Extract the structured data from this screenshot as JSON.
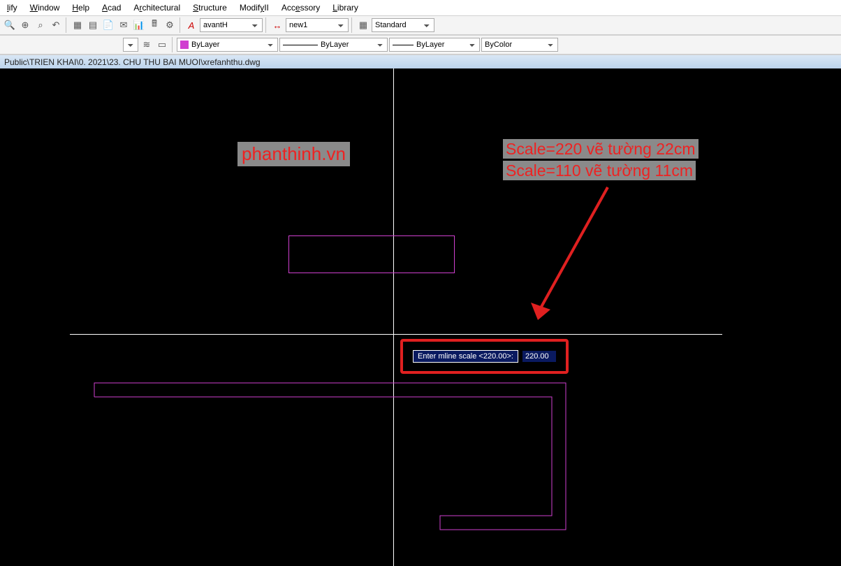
{
  "menu": {
    "items": [
      {
        "pre": "",
        "u": "l",
        "post": "ify"
      },
      {
        "pre": "",
        "u": "W",
        "post": "indow"
      },
      {
        "pre": "",
        "u": "H",
        "post": "elp"
      },
      {
        "pre": "",
        "u": "A",
        "post": "cad"
      },
      {
        "pre": "A",
        "u": "r",
        "post": "chitectural"
      },
      {
        "pre": "",
        "u": "S",
        "post": "tructure"
      },
      {
        "pre": "Modif",
        "u": "y",
        "post": "II"
      },
      {
        "pre": "Acc",
        "u": "e",
        "post": "ssory"
      },
      {
        "pre": "",
        "u": "L",
        "post": "ibrary"
      }
    ]
  },
  "toolbar1": {
    "icons": [
      "zoom-realtime",
      "zoom-in",
      "zoom-window",
      "zoom-previous",
      "tool-a",
      "tool-b",
      "tool-c",
      "tool-d",
      "tool-e",
      "tool-f",
      "calc",
      "settings"
    ],
    "style_select": "avantH",
    "style2_select": "new1",
    "style3_select": "Standard"
  },
  "toolbar2": {
    "layer_color": "#d040d0",
    "layer_select": "ByLayer",
    "linetype_select": "ByLayer",
    "lineweight_select": "ByLayer",
    "color_select": "ByColor"
  },
  "titlebar": "Public\\TRIEN KHAI\\0. 2021\\23. CHU THU BAI MUOI\\xrefanhthu.dwg",
  "canvas": {
    "watermark": "phanthinh.vn",
    "annotation_line1": "Scale=220 vẽ tường 22cm",
    "annotation_line2": "Scale=110 vẽ tường 11cm",
    "prompt_label": "Enter mline scale <220.00>:",
    "prompt_value": "220.00"
  }
}
